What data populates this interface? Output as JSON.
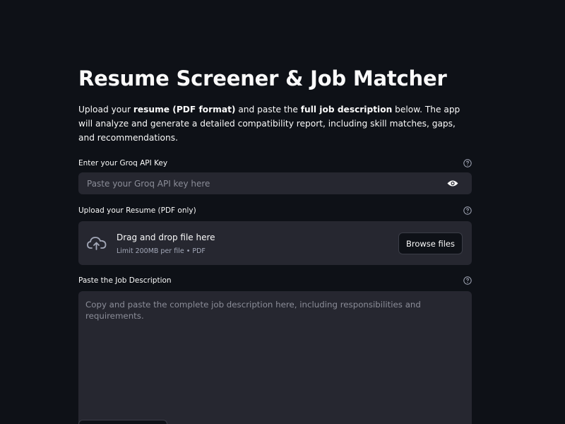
{
  "page": {
    "title": "Resume Screener & Job Matcher",
    "intro": {
      "text_1": "Upload your ",
      "bold_1": "resume (PDF format)",
      "text_2": " and paste the ",
      "bold_2": "full job description",
      "text_3": " below. The app will analyze and generate a detailed compatibility report, including skill matches, gaps, and recommendations."
    }
  },
  "api_key": {
    "label": "Enter your Groq API Key",
    "placeholder": "Paste your Groq API key here",
    "value": "",
    "help_icon": "help-circle-icon",
    "toggle_icon": "eye-icon"
  },
  "resume_upload": {
    "label": "Upload your Resume (PDF only)",
    "drop_title": "Drag and drop file here",
    "drop_subtitle": "Limit 200MB per file • PDF",
    "browse_label": "Browse files",
    "icon": "cloud-upload-icon",
    "help_icon": "help-circle-icon"
  },
  "job_description": {
    "label": "Paste the Job Description",
    "placeholder": "Copy and paste the complete job description here, including responsibilities and requirements.",
    "value": "",
    "help_icon": "help-circle-icon"
  },
  "colors": {
    "background": "#0e1117",
    "input_bg": "#262730",
    "text": "#fafafa",
    "placeholder": "#8b8d98",
    "muted": "#a3a8b8"
  }
}
